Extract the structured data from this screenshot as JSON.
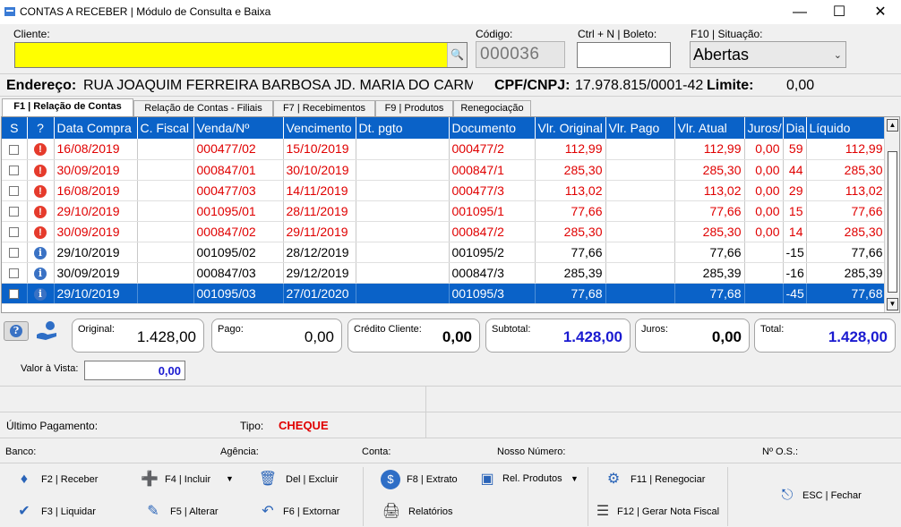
{
  "window": {
    "title": "CONTAS A RECEBER | Módulo de Consulta e Baixa"
  },
  "form": {
    "cliente_label": "Cliente:",
    "codigo_label": "Código:",
    "codigo_value": "000036",
    "boleto_label": "Ctrl + N | Boleto:",
    "situacao_label": "F10 | Situação:",
    "situacao_value": "Abertas",
    "endereco_label": "Endereço:",
    "endereco_value": "RUA JOAQUIM FERREIRA BARBOSA JD. MARIA DO CARMO",
    "cpf_label": "CPF/CNPJ:",
    "cpf_value": "17.978.815/0001-42",
    "limite_label": "Limite:",
    "limite_value": "0,00"
  },
  "tabs": [
    "F1 | Relação de Contas",
    "Relação de Contas - Filiais",
    "F7 | Recebimentos",
    "F9 | Produtos",
    "Renegociação"
  ],
  "grid": {
    "headers": [
      "S",
      "?",
      "Data Compra",
      "C. Fiscal",
      "Venda/Nº",
      "Vencimento",
      "Dt. pgto",
      "Documento",
      "Vlr. Original",
      "Vlr. Pago",
      "Vlr. Atual",
      "Juros/",
      "Dia",
      "Líquido"
    ],
    "rows": [
      {
        "status": "warn",
        "red": true,
        "selected": false,
        "data_compra": "16/08/2019",
        "c_fiscal": "",
        "venda": "000477/02",
        "vencimento": "15/10/2019",
        "dt_pgto": "",
        "documento": "000477/2",
        "vlr_original": "112,99",
        "vlr_pago": "",
        "vlr_atual": "112,99",
        "juros": "0,00",
        "dia": "59",
        "liquido": "112,99"
      },
      {
        "status": "warn",
        "red": true,
        "selected": false,
        "data_compra": "30/09/2019",
        "c_fiscal": "",
        "venda": "000847/01",
        "vencimento": "30/10/2019",
        "dt_pgto": "",
        "documento": "000847/1",
        "vlr_original": "285,30",
        "vlr_pago": "",
        "vlr_atual": "285,30",
        "juros": "0,00",
        "dia": "44",
        "liquido": "285,30"
      },
      {
        "status": "warn",
        "red": true,
        "selected": false,
        "data_compra": "16/08/2019",
        "c_fiscal": "",
        "venda": "000477/03",
        "vencimento": "14/11/2019",
        "dt_pgto": "",
        "documento": "000477/3",
        "vlr_original": "113,02",
        "vlr_pago": "",
        "vlr_atual": "113,02",
        "juros": "0,00",
        "dia": "29",
        "liquido": "113,02"
      },
      {
        "status": "warn",
        "red": true,
        "selected": false,
        "data_compra": "29/10/2019",
        "c_fiscal": "",
        "venda": "001095/01",
        "vencimento": "28/11/2019",
        "dt_pgto": "",
        "documento": "001095/1",
        "vlr_original": "77,66",
        "vlr_pago": "",
        "vlr_atual": "77,66",
        "juros": "0,00",
        "dia": "15",
        "liquido": "77,66"
      },
      {
        "status": "warn",
        "red": true,
        "selected": false,
        "data_compra": "30/09/2019",
        "c_fiscal": "",
        "venda": "000847/02",
        "vencimento": "29/11/2019",
        "dt_pgto": "",
        "documento": "000847/2",
        "vlr_original": "285,30",
        "vlr_pago": "",
        "vlr_atual": "285,30",
        "juros": "0,00",
        "dia": "14",
        "liquido": "285,30"
      },
      {
        "status": "info",
        "red": false,
        "selected": false,
        "data_compra": "29/10/2019",
        "c_fiscal": "",
        "venda": "001095/02",
        "vencimento": "28/12/2019",
        "dt_pgto": "",
        "documento": "001095/2",
        "vlr_original": "77,66",
        "vlr_pago": "",
        "vlr_atual": "77,66",
        "juros": "",
        "dia": "-15",
        "liquido": "77,66"
      },
      {
        "status": "info",
        "red": false,
        "selected": false,
        "data_compra": "30/09/2019",
        "c_fiscal": "",
        "venda": "000847/03",
        "vencimento": "29/12/2019",
        "dt_pgto": "",
        "documento": "000847/3",
        "vlr_original": "285,39",
        "vlr_pago": "",
        "vlr_atual": "285,39",
        "juros": "",
        "dia": "-16",
        "liquido": "285,39"
      },
      {
        "status": "info",
        "red": false,
        "selected": true,
        "data_compra": "29/10/2019",
        "c_fiscal": "",
        "venda": "001095/03",
        "vencimento": "27/01/2020",
        "dt_pgto": "",
        "documento": "001095/3",
        "vlr_original": "77,68",
        "vlr_pago": "",
        "vlr_atual": "77,68",
        "juros": "",
        "dia": "-45",
        "liquido": "77,68"
      }
    ]
  },
  "totals": {
    "original_label": "Original:",
    "original_value": "1.428,00",
    "pago_label": "Pago:",
    "pago_value": "0,00",
    "credito_label": "Crédito Cliente:",
    "credito_value": "0,00",
    "subtotal_label": "Subtotal:",
    "subtotal_value": "1.428,00",
    "juros_label": "Juros:",
    "juros_value": "0,00",
    "total_label": "Total:",
    "total_value": "1.428,00"
  },
  "vista": {
    "label": "Valor à Vista:",
    "value": "0,00"
  },
  "pagamento": {
    "ultimo_label": "Último Pagamento:",
    "tipo_label": "Tipo:",
    "tipo_value": "CHEQUE"
  },
  "bank": {
    "banco": "Banco:",
    "agencia": "Agência:",
    "conta": "Conta:",
    "nosso_numero": "Nosso Número:",
    "os": "Nº O.S.:"
  },
  "toolbar": {
    "receber": "F2 | Receber",
    "liquidar": "F3 | Liquidar",
    "incluir": "F4 | Incluir",
    "alterar": "F5 | Alterar",
    "excluir": "Del | Excluir",
    "extornar": "F6 | Extornar",
    "extrato": "F8 | Extrato",
    "relatorios": "Relatórios",
    "rel_produtos": "Rel. Produtos",
    "renegociar": "F11 | Renegociar",
    "nota_fiscal": "F12 | Gerar Nota Fiscal",
    "fechar": "ESC | Fechar"
  },
  "colors": {
    "accent": "#0a62c8",
    "yellow": "#ffff00",
    "overdue": "#e00000",
    "total_blue": "#1a1ad0"
  }
}
